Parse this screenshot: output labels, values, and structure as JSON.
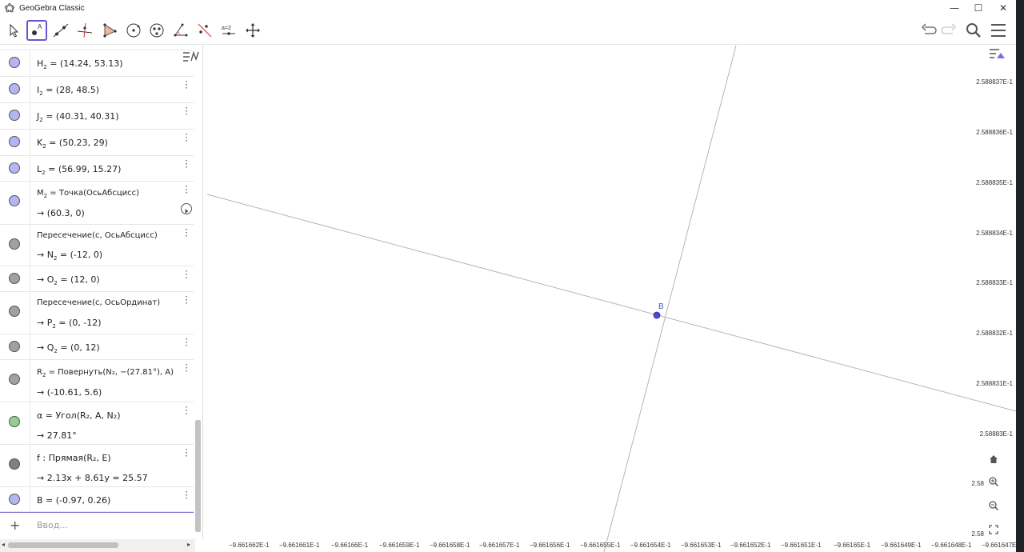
{
  "window": {
    "title": "GeoGebra Classic",
    "minimize": "—",
    "maximize": "☐",
    "close": "✕"
  },
  "toolbar": {
    "tools": [
      {
        "name": "move-tool",
        "icon": "arrow-icon"
      },
      {
        "name": "point-tool",
        "icon": "point-icon",
        "label": "A",
        "active": true
      },
      {
        "name": "line-tool",
        "icon": "line-icon"
      },
      {
        "name": "perpendicular-tool",
        "icon": "perpendicular-icon"
      },
      {
        "name": "polygon-tool",
        "icon": "polygon-icon"
      },
      {
        "name": "circle-tool",
        "icon": "circle-icon"
      },
      {
        "name": "conic-tool",
        "icon": "ellipse-icon"
      },
      {
        "name": "angle-tool",
        "icon": "angle-icon"
      },
      {
        "name": "reflect-tool",
        "icon": "reflect-icon"
      },
      {
        "name": "slider-tool",
        "icon": "slider-icon",
        "label": "a=2"
      },
      {
        "name": "move-graphics-tool",
        "icon": "move-view-icon"
      }
    ]
  },
  "algebra": {
    "rows": [
      {
        "name": "H2",
        "line1_main": "H",
        "line1_sub": "2",
        "line1_rest": " = (14.24, 53.13)",
        "color": "#b3b6f2"
      },
      {
        "name": "I2",
        "line1_main": "I",
        "line1_sub": "2",
        "line1_rest": " = (28, 48.5)",
        "color": "#b3b6f2"
      },
      {
        "name": "J2",
        "line1_main": "J",
        "line1_sub": "2",
        "line1_rest": " = (40.31, 40.31)",
        "color": "#b3b6f2"
      },
      {
        "name": "K2",
        "line1_main": "K",
        "line1_sub": "2",
        "line1_rest": " = (50.23, 29)",
        "color": "#b3b6f2"
      },
      {
        "name": "L2",
        "line1_main": "L",
        "line1_sub": "2",
        "line1_rest": " = (56.99, 15.27)",
        "color": "#b3b6f2"
      },
      {
        "name": "M2",
        "line1_main": "M",
        "line1_sub": "2",
        "line1_rest": " = Точка(ОсьАбсцисс)",
        "line2": "→ (60.3, 0)",
        "color": "#b3b6f2"
      },
      {
        "name": "N2",
        "line1_text": "Пересечение(c, ОсьАбсцисс)",
        "line2_main": "→ N",
        "line2_sub": "2",
        "line2_rest": " = (-12, 0)",
        "color": "#a0a0a0"
      },
      {
        "name": "O2",
        "line1_main": "→ O",
        "line1_sub": "2",
        "line1_rest": " = (12, 0)",
        "color": "#a0a0a0"
      },
      {
        "name": "P2",
        "line1_text": "Пересечение(c, ОсьОрдинат)",
        "line2_main": "→ P",
        "line2_sub": "2",
        "line2_rest": " = (0, -12)",
        "color": "#a0a0a0"
      },
      {
        "name": "Q2",
        "line1_main": "→ Q",
        "line1_sub": "2",
        "line1_rest": " = (0, 12)",
        "color": "#a0a0a0"
      },
      {
        "name": "R2",
        "line1_main": "R",
        "line1_sub": "2",
        "line1_rest": " = Повернуть(N₂, −(27.81°), A)",
        "line2": "→ (-10.61, 5.6)",
        "color": "#a0a0a0"
      },
      {
        "name": "alpha",
        "line1_text": "α = Угол(R₂, A, N₂)",
        "line2": "→ 27.81°",
        "color": "#8fd18f"
      },
      {
        "name": "f",
        "line1_text": "f : Прямая(R₂, E)",
        "line2": "→ 2.13x + 8.61y = 25.57",
        "color": "#808080"
      },
      {
        "name": "B",
        "line1_text": "B = (-0.97, 0.26)",
        "color": "#b3b6f2"
      }
    ],
    "input_placeholder": "Ввод...",
    "input_plus": "+"
  },
  "graphics": {
    "point_label": "B",
    "y_ticks": [
      "2.588837E-1",
      "2.588836E-1",
      "2.588835E-1",
      "2.588834E-1",
      "2.588833E-1",
      "2.588832E-1",
      "2.588831E-1",
      "2.58883E-1",
      "2.58",
      "2.58"
    ],
    "x_ticks": [
      "−9.661662E-1",
      "−9.661661E-1",
      "−9.66166E-1",
      "−9.661659E-1",
      "−9.661658E-1",
      "−9.661657E-1",
      "−9.661656E-1",
      "−9.661655E-1",
      "−9.661654E-1",
      "−9.661653E-1",
      "−9.661652E-1",
      "−9.661651E-1",
      "−9.66165E-1",
      "−9.661649E-1",
      "−9.661648E-1",
      "−9.661647E"
    ]
  }
}
